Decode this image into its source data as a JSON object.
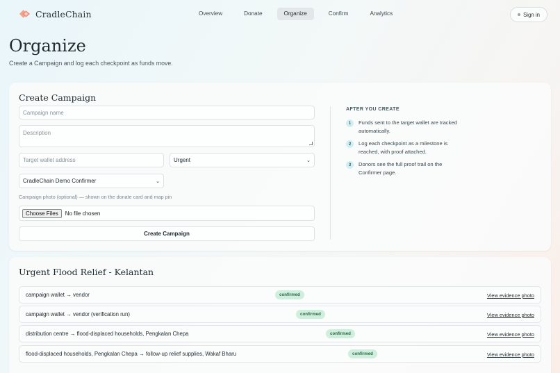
{
  "header": {
    "brand": "CradleChain",
    "nav": [
      "Overview",
      "Donate",
      "Organize",
      "Confirm",
      "Analytics"
    ],
    "active_nav": "Organize",
    "signin_label": "Sign in"
  },
  "page": {
    "title": "Organize",
    "subtitle": "Create a Campaign and log each checkpoint as funds move."
  },
  "create_form": {
    "title": "Create Campaign",
    "campaign_name_placeholder": "Campaign name",
    "description_placeholder": "Description",
    "target_wallet_placeholder": "Target wallet address",
    "urgency_value": "Urgent",
    "confirmer_value": "CradleChain Demo Confirmer",
    "photo_hint": "Campaign photo (optional) — shown on the donate card and map pin",
    "file_button": "Choose Files",
    "file_status": "No file chosen",
    "submit_label": "Create Campaign"
  },
  "after_create": {
    "heading": "AFTER YOU CREATE",
    "steps": [
      {
        "num": "1",
        "text": "Funds sent to the target wallet are tracked automatically."
      },
      {
        "num": "2",
        "text": "Log each checkpoint as a milestone is reached, with proof attached."
      },
      {
        "num": "3",
        "text": "Donors see the full proof trail on the Confirmer page."
      }
    ]
  },
  "campaign": {
    "title": "Urgent Flood Relief - Kelantan",
    "rows": [
      {
        "route": "campaign wallet → vendor",
        "status": "confirmed",
        "link": "View evidence photo"
      },
      {
        "route": "campaign wallet → vendor (verification run)",
        "status": "confirmed",
        "link": "View evidence photo"
      },
      {
        "route": "distribution centre → flood-displaced households, Pengkalan Chepa",
        "status": "confirmed",
        "link": "View evidence photo"
      },
      {
        "route": "flood-displaced households, Pengkalan Chepa → follow-up relief supplies, Wakaf Bharu",
        "status": "confirmed",
        "link": "View evidence photo"
      }
    ]
  },
  "colors": {
    "badge_bg": "#cfeedd",
    "badge_text": "#2f6a47",
    "logo": "#f08a6f"
  }
}
